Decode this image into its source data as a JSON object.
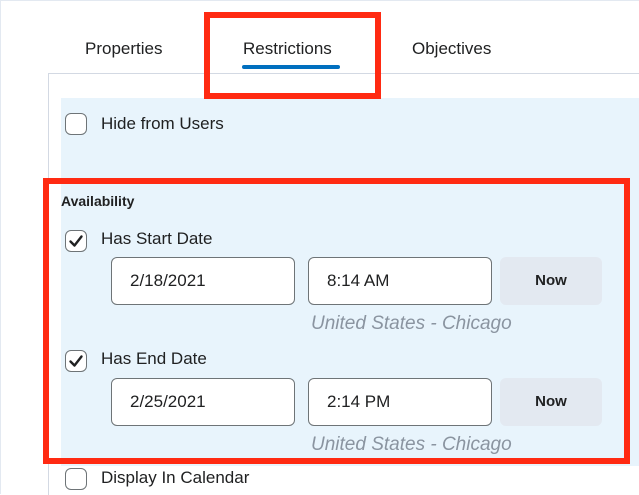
{
  "tabs": [
    {
      "label": "Properties"
    },
    {
      "label": "Restrictions"
    },
    {
      "label": "Objectives"
    }
  ],
  "hide_from_users": {
    "label": "Hide from Users",
    "checked": false
  },
  "availability": {
    "title": "Availability",
    "start": {
      "label": "Has Start Date",
      "checked": true,
      "date": "2/18/2021",
      "time": "8:14 AM",
      "now_label": "Now",
      "timezone": "United States - Chicago"
    },
    "end": {
      "label": "Has End Date",
      "checked": true,
      "date": "2/25/2021",
      "time": "2:14 PM",
      "now_label": "Now",
      "timezone": "United States - Chicago"
    }
  },
  "display_in_calendar": {
    "label": "Display In Calendar",
    "checked": false
  },
  "colors": {
    "accent": "#006fbf",
    "highlight": "#ff2a12",
    "panel_bg": "#e8f4fc"
  }
}
